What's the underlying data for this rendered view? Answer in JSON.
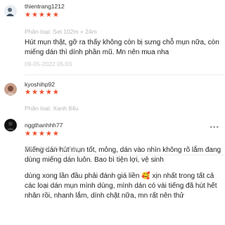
{
  "reviews": [
    {
      "username": "thientrang1212",
      "stars": "★★★★★",
      "variant": "Phân loại: Set 102m + 24m",
      "comment": "Hút mụn thật, gỡ ra thấy không còn bị sưng chỗ mụn nữa, còn miếng dán thì dính phần mũ. Mn nên mua nha",
      "date": "09-05-2022 05:03"
    },
    {
      "username": "kyoshihp92",
      "stars": "★★★★★",
      "variant": "Phân loại: Xanh 84u",
      "comment": "Miếng dán hút mụn tốt, mỏng, dán vào nhìn không rõ lắm đang dùng miếng dán luôn. Bao bì tiện lợi, vệ sinh"
    },
    {
      "username": "nggthanhhh77",
      "stars": "★★★★★",
      "variant": "Phân loại: Xanh 84u",
      "comment": "dùng xong lần đầu phải đánh giá liền 🥰 xịn nhất trong tất cả các loại dán mụn mình dùng, mình dán có vài tiếng đã hút hết nhân rồi, nhanh lắm, dính chặt nữa, mn rất nên thử"
    }
  ],
  "colors": {
    "star": "#ee4d2d",
    "muted": "#b8b8b8"
  }
}
